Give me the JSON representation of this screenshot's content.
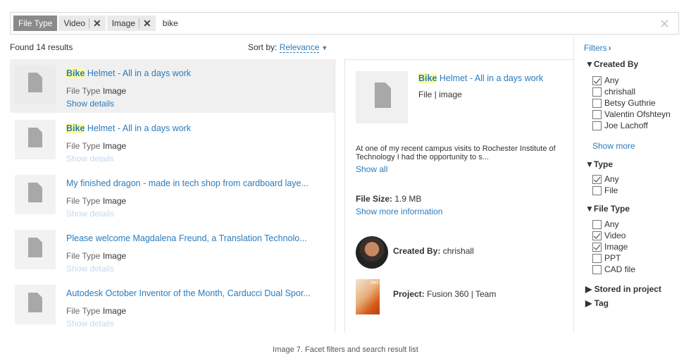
{
  "search": {
    "facet_label": "File Type",
    "chips": [
      {
        "label": "Video"
      },
      {
        "label": "Image"
      }
    ],
    "query": "bike"
  },
  "results_header": {
    "found": "Found 14 results",
    "sort_label": "Sort by:",
    "sort_value": "Relevance"
  },
  "results": [
    {
      "title_hl": "Bike",
      "title_rest": " Helmet - All in a days work",
      "type_label": "File Type",
      "type_value": "Image",
      "details": "Show details",
      "selected": true
    },
    {
      "title_hl": "Bike",
      "title_rest": " Helmet - All in a days work",
      "type_label": "File Type",
      "type_value": "Image",
      "details": "Show details"
    },
    {
      "title_hl": "",
      "title_rest": "My finished dragon - made in tech shop from cardboard laye...",
      "type_label": "File Type",
      "type_value": "Image",
      "details": "Show details"
    },
    {
      "title_hl": "",
      "title_rest": "Please welcome Magdalena Freund, a Translation Technolo...",
      "type_label": "File Type",
      "type_value": "Image",
      "details": "Show details"
    },
    {
      "title_hl": "",
      "title_rest": "Autodesk October Inventor of the Month, Carducci Dual Spor...",
      "type_label": "File Type",
      "type_value": "Image",
      "details": "Show details"
    }
  ],
  "detail": {
    "title_hl": "Bike",
    "title_rest": " Helmet - All in a days work",
    "subtitle": "File | image",
    "description": "At one of my recent campus visits to Rochester Institute of Technology I had the opportunity to s...",
    "show_all": "Show all",
    "file_size_label": "File Size:",
    "file_size_value": "1.9 MB",
    "show_more_info": "Show more information",
    "created_by_label": "Created By:",
    "created_by_value": "chrishall",
    "project_label": "Project:",
    "project_value": "Fusion 360 | Team",
    "project_icon_text": "360"
  },
  "filters": {
    "header": "Filters",
    "created_by": {
      "title": "▼Created By",
      "options": [
        {
          "label": "Any",
          "checked": true
        },
        {
          "label": "chrishall",
          "checked": false
        },
        {
          "label": "Betsy Guthrie",
          "checked": false
        },
        {
          "label": "Valentin Ofshteyn",
          "checked": false
        },
        {
          "label": "Joe Lachoff",
          "checked": false
        }
      ],
      "show_more": "Show more"
    },
    "type": {
      "title": "▼Type",
      "options": [
        {
          "label": "Any",
          "checked": true
        },
        {
          "label": "File",
          "checked": false
        }
      ]
    },
    "file_type": {
      "title": "▼File Type",
      "options": [
        {
          "label": "Any",
          "checked": false
        },
        {
          "label": "Video",
          "checked": true
        },
        {
          "label": "Image",
          "checked": true
        },
        {
          "label": "PPT",
          "checked": false
        },
        {
          "label": "CAD file",
          "checked": false
        }
      ]
    },
    "stored_in_project": "▶ Stored in project",
    "tag": "▶ Tag"
  },
  "caption": "Image 7. Facet filters and search result list",
  "colors": {
    "link": "#2a7bbd",
    "highlight": "#ffff9c",
    "chip_label": "#8a8a8a"
  }
}
